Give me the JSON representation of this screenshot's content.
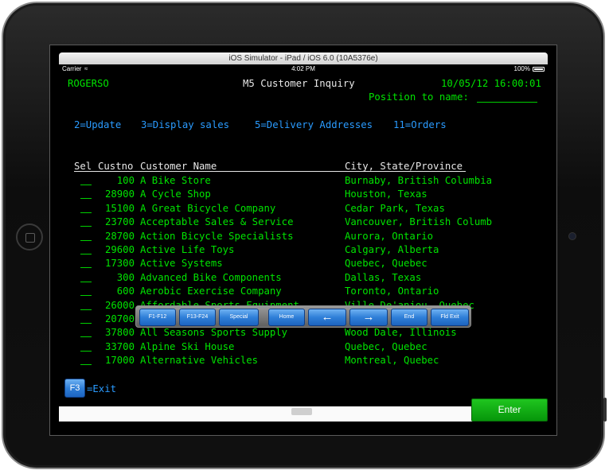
{
  "simulator": {
    "title": "iOS Simulator - iPad / iOS 6.0 (10A5376e)"
  },
  "status_bar": {
    "carrier": "Carrier",
    "wifi_icon": "wifi-icon",
    "time": "4:02 PM",
    "battery": "100%"
  },
  "screen": {
    "user": "ROGERSO",
    "title": "M5 Customer Inquiry",
    "datetime": "10/05/12 16:00:01",
    "position_label": "Position to name:",
    "options": [
      "2=Update",
      "3=Display sales",
      "5=Delivery Addresses",
      "11=Orders"
    ],
    "columns": {
      "sel": "Sel",
      "custno": "Custno",
      "name": "Customer Name",
      "city": "City, State/Province"
    },
    "rows": [
      {
        "custno": "100",
        "name": "A Bike Store",
        "city": "Burnaby, British Columbia"
      },
      {
        "custno": "28900",
        "name": "A Cycle Shop",
        "city": "Houston, Texas"
      },
      {
        "custno": "15100",
        "name": "A Great Bicycle Company",
        "city": "Cedar Park, Texas"
      },
      {
        "custno": "23700",
        "name": "Acceptable Sales & Service",
        "city": "Vancouver, British Columb"
      },
      {
        "custno": "28700",
        "name": "Action Bicycle Specialists",
        "city": "Aurora, Ontario"
      },
      {
        "custno": "29600",
        "name": "Active Life Toys",
        "city": "Calgary, Alberta"
      },
      {
        "custno": "17300",
        "name": "Active Systems",
        "city": "Quebec, Quebec"
      },
      {
        "custno": "300",
        "name": "Advanced Bike Components",
        "city": "Dallas, Texas"
      },
      {
        "custno": "600",
        "name": "Aerobic Exercise Company",
        "city": "Toronto, Ontario"
      },
      {
        "custno": "26000",
        "name": "Affordable Sports Equipment",
        "city": "Ville De'anjou, Quebec"
      },
      {
        "custno": "20700",
        "name": "",
        "city": ""
      },
      {
        "custno": "37800",
        "name": "All Seasons Sports Supply",
        "city": "Wood Dale, Illinois"
      },
      {
        "custno": "33700",
        "name": "Alpine Ski House",
        "city": "Quebec, Quebec"
      },
      {
        "custno": "17000",
        "name": "Alternative Vehicles",
        "city": "Montreal, Quebec"
      }
    ],
    "exit_label": "=Exit"
  },
  "softkeys": {
    "f1_f12": "F1-F12",
    "f13_f24": "F13-F24",
    "special": "Special",
    "home": "Home",
    "left_arrow": "←",
    "right_arrow": "→",
    "end": "End",
    "fld_exit": "Fld Exit"
  },
  "f3_key": "F3",
  "enter": "Enter",
  "colors": {
    "terminal_green": "#00e400",
    "terminal_blue": "#2a9bff",
    "enter_green": "#06960a",
    "key_blue": "#2f7fd8"
  }
}
